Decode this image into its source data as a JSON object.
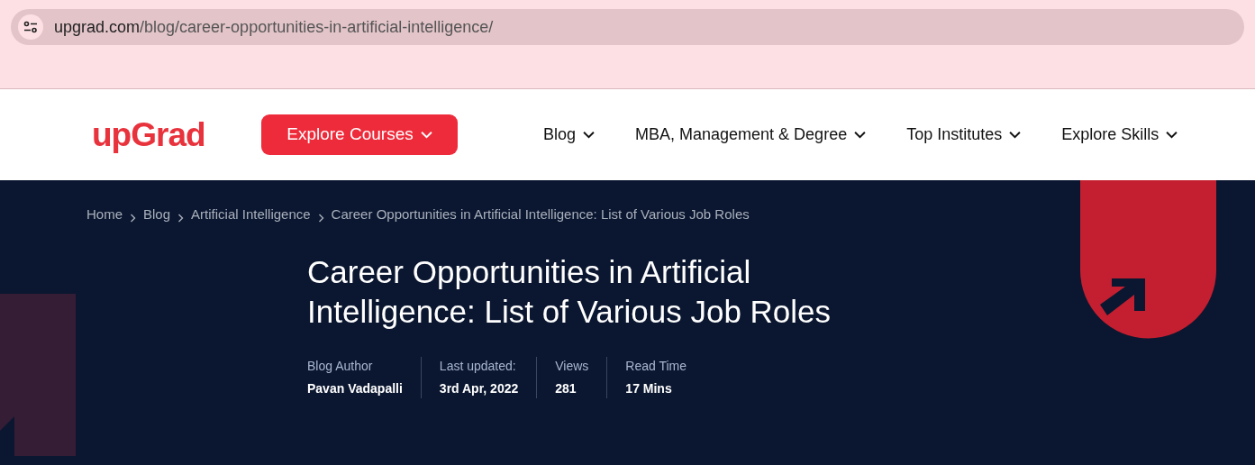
{
  "browser": {
    "url_host": "upgrad.com",
    "url_path": "/blog/career-opportunities-in-artificial-intelligence/"
  },
  "nav": {
    "logo": "upGrad",
    "explore_button": "Explore Courses",
    "items": [
      "Blog",
      "MBA, Management & Degree",
      "Top Institutes",
      "Explore Skills"
    ]
  },
  "breadcrumb": [
    "Home",
    "Blog",
    "Artificial Intelligence",
    "Career Opportunities in Artificial Intelligence: List of Various Job Roles"
  ],
  "title": "Career Opportunities in Artificial Intelligence: List of Various Job Roles",
  "meta": [
    {
      "label": "Blog Author",
      "value": "Pavan Vadapalli"
    },
    {
      "label": "Last updated:",
      "value": "3rd Apr, 2022"
    },
    {
      "label": "Views",
      "value": "281"
    },
    {
      "label": "Read Time",
      "value": "17 Mins"
    }
  ]
}
